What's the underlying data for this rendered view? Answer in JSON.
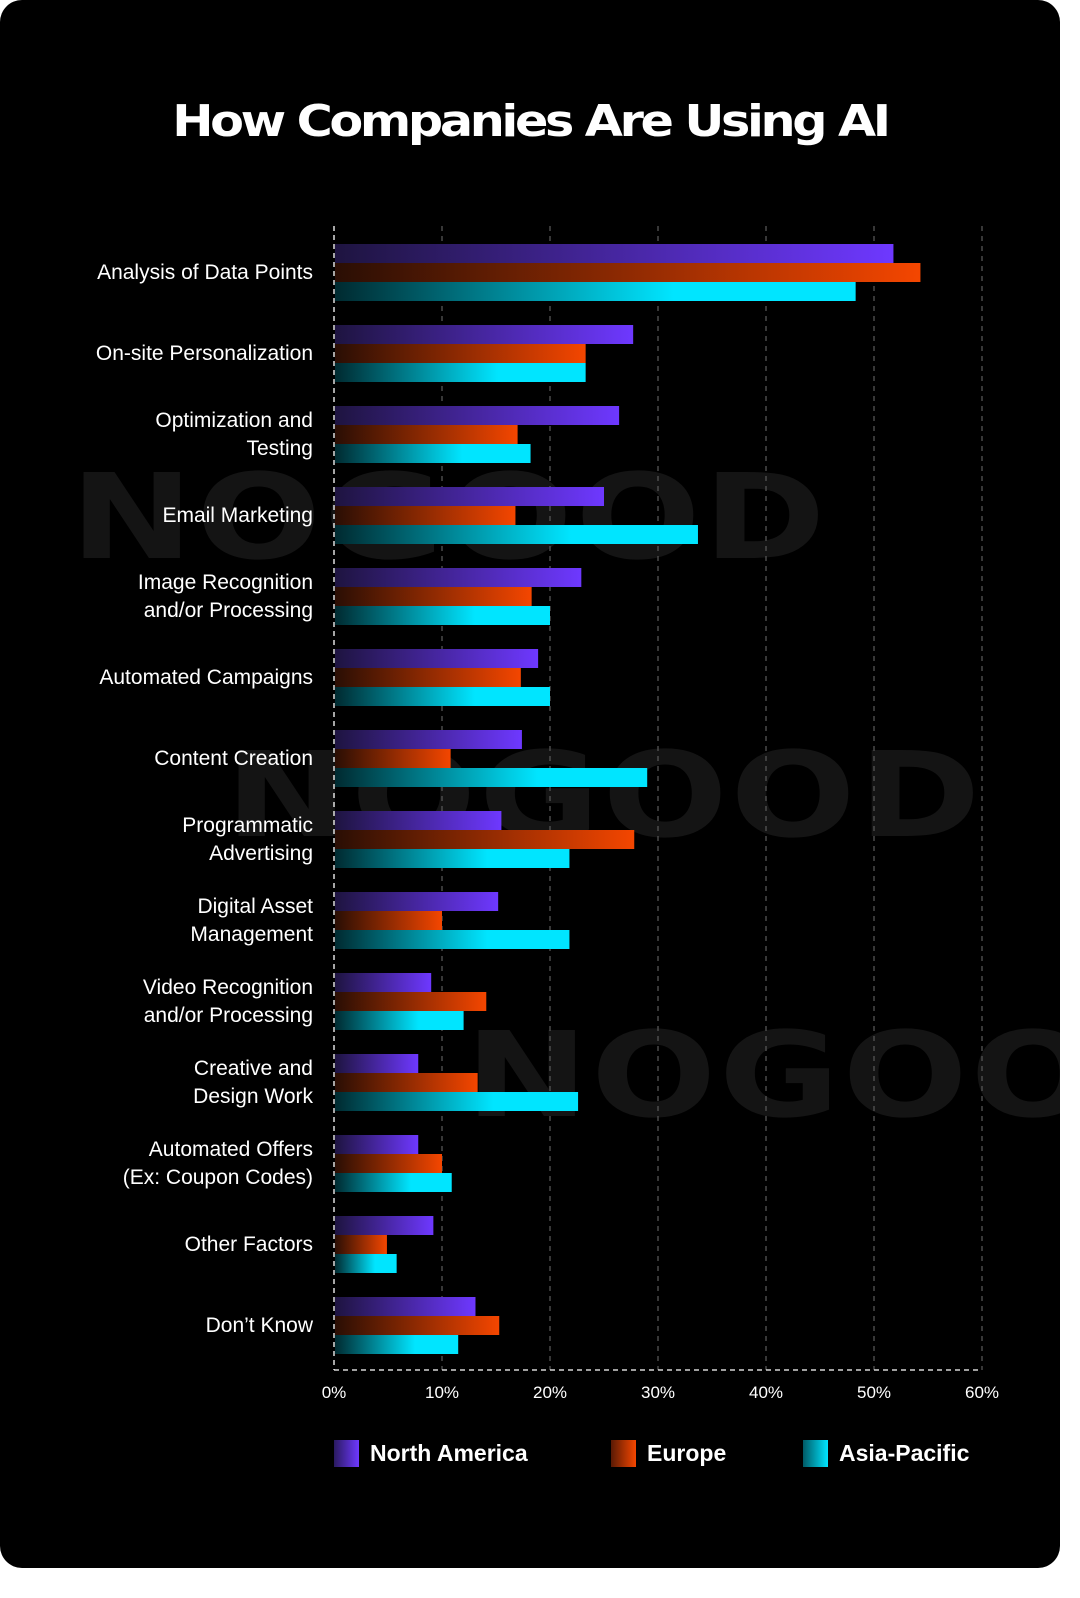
{
  "chart_data": {
    "type": "bar",
    "orientation": "horizontal",
    "title": "How Companies Are Using AI",
    "xlabel": "",
    "ylabel": "",
    "xlim": [
      0,
      60
    ],
    "x_ticks": [
      "0%",
      "10%",
      "20%",
      "30%",
      "40%",
      "50%",
      "60%"
    ],
    "x_tick_values": [
      0,
      10,
      20,
      30,
      40,
      50,
      60
    ],
    "grid": true,
    "legend_position": "bottom",
    "categories": [
      "Analysis of Data Points",
      "On-site Personalization",
      "Optimization and\nTesting",
      "Email Marketing",
      "Image Recognition\nand/or Processing",
      "Automated Campaigns",
      "Content Creation",
      "Programmatic\nAdvertising",
      "Digital Asset\nManagement",
      "Video Recognition\nand/or Processing",
      "Creative and\nDesign Work",
      "Automated Offers\n(Ex: Coupon Codes)",
      "Other Factors",
      "Don’t Know"
    ],
    "series": [
      {
        "name": "North America",
        "color": "#6e38ff",
        "values": [
          51.8,
          27.7,
          26.4,
          25.0,
          22.9,
          18.9,
          17.4,
          15.5,
          15.2,
          9.0,
          7.8,
          7.8,
          9.2,
          13.1
        ]
      },
      {
        "name": "Europe",
        "color": "#f44600",
        "values": [
          54.3,
          23.3,
          17.0,
          16.8,
          18.3,
          17.3,
          10.8,
          27.8,
          10.0,
          14.1,
          13.3,
          10.0,
          4.9,
          15.3
        ]
      },
      {
        "name": "Asia-Pacific",
        "color": "#00e5ff",
        "values": [
          48.3,
          23.3,
          18.2,
          33.7,
          20.0,
          20.0,
          29.0,
          21.8,
          21.8,
          12.0,
          22.6,
          10.9,
          5.8,
          11.5
        ]
      }
    ]
  },
  "watermark": "NOGOOD",
  "legend": [
    {
      "label": "North America"
    },
    {
      "label": "Europe"
    },
    {
      "label": "Asia-Pacific"
    }
  ]
}
